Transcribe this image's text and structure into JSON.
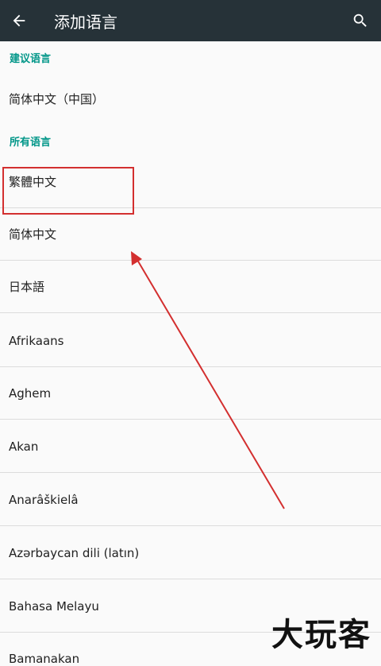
{
  "appbar": {
    "title": "添加语言",
    "back_icon": "arrow-left-icon",
    "search_icon": "search-icon",
    "background": "#263238"
  },
  "sections": {
    "suggested": "建议语言",
    "all": "所有语言"
  },
  "suggested_languages": [
    "简体中文（中国）"
  ],
  "all_languages": [
    "繁體中文",
    "简体中文",
    "日本語",
    "Afrikaans",
    "Aghem",
    "Akan",
    "Anarâškielâ",
    "Azərbaycan dili (latın)",
    "Bahasa Melayu",
    "Bamanakan"
  ],
  "accent_color": "#009688",
  "annotation_color": "#d32f2f",
  "watermark": "大玩客"
}
